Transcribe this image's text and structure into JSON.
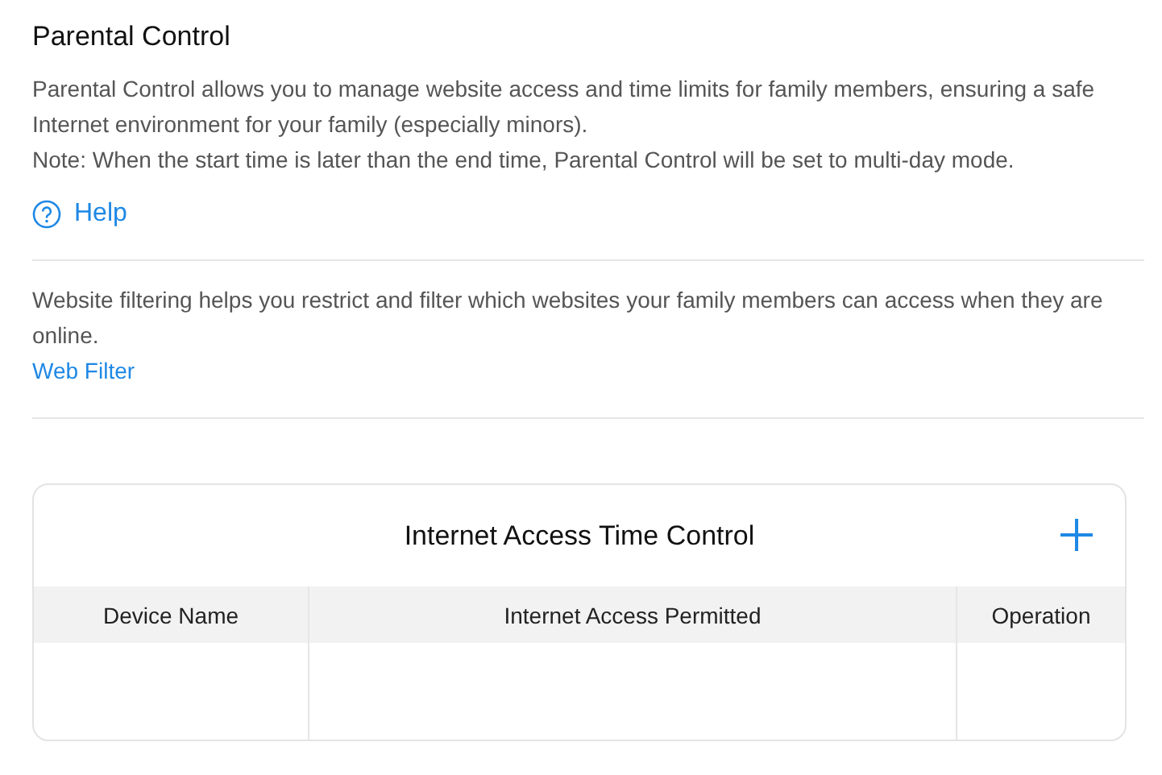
{
  "page": {
    "title": "Parental Control",
    "description": "Parental Control allows you to manage website access and time limits for family members, ensuring a safe Internet environment for your family (especially minors).",
    "note": "Note: When the start time is later than the end time, Parental Control will be set to multi-day mode.",
    "help_link": "Help"
  },
  "web_filter": {
    "description": "Website filtering helps you restrict and filter which websites your family members can access when they are online.",
    "link": "Web Filter"
  },
  "time_control": {
    "title": "Internet Access Time Control",
    "table": {
      "columns": [
        "Device Name",
        "Internet Access Permitted",
        "Operation"
      ]
    }
  }
}
